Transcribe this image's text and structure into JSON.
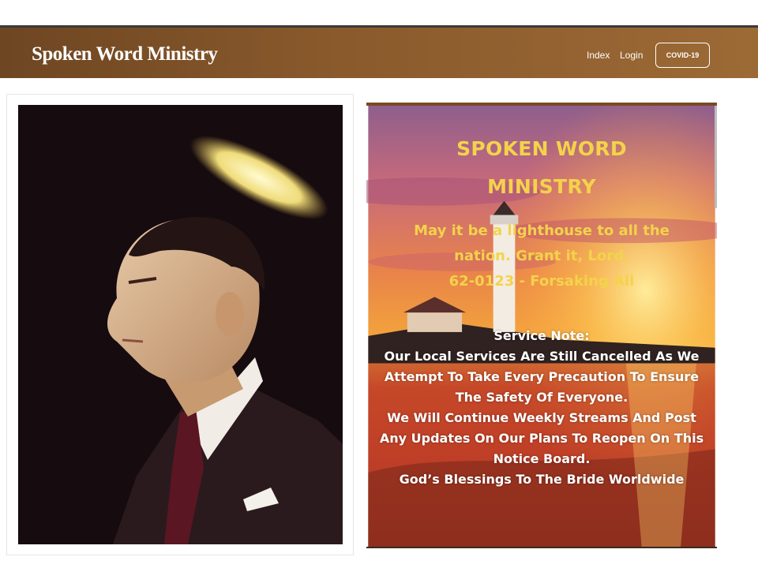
{
  "header": {
    "brand": "Spoken Word Ministry",
    "nav": {
      "index": "Index",
      "login": "Login",
      "covid": "COVID-19"
    }
  },
  "notice": {
    "title_line1": "SPOKEN WORD",
    "title_line2": "MINISTRY",
    "subtitle_line1": "May it be a lighthouse to all the",
    "subtitle_line2": "nation. Grant it, Lord.",
    "subtitle_line3": "62-0123 - Forsaking All",
    "heading": "Service Note:",
    "body_lines": [
      "Our Local Services Are Still Cancelled As We",
      "Attempt To Take Every Precaution To Ensure",
      "The Safety Of Everyone.",
      "We Will Continue Weekly Streams And Post",
      "Any Updates On Our Plans To Reopen On This",
      "Notice Board.",
      "God’s Blessings To The Bride Worldwide"
    ]
  },
  "colors": {
    "brand_bar": "#8a5a2c",
    "title_yellow": "#f3d34a"
  },
  "icons": {
    "portrait": "portrait-image",
    "lighthouse": "lighthouse-sunset-image"
  }
}
